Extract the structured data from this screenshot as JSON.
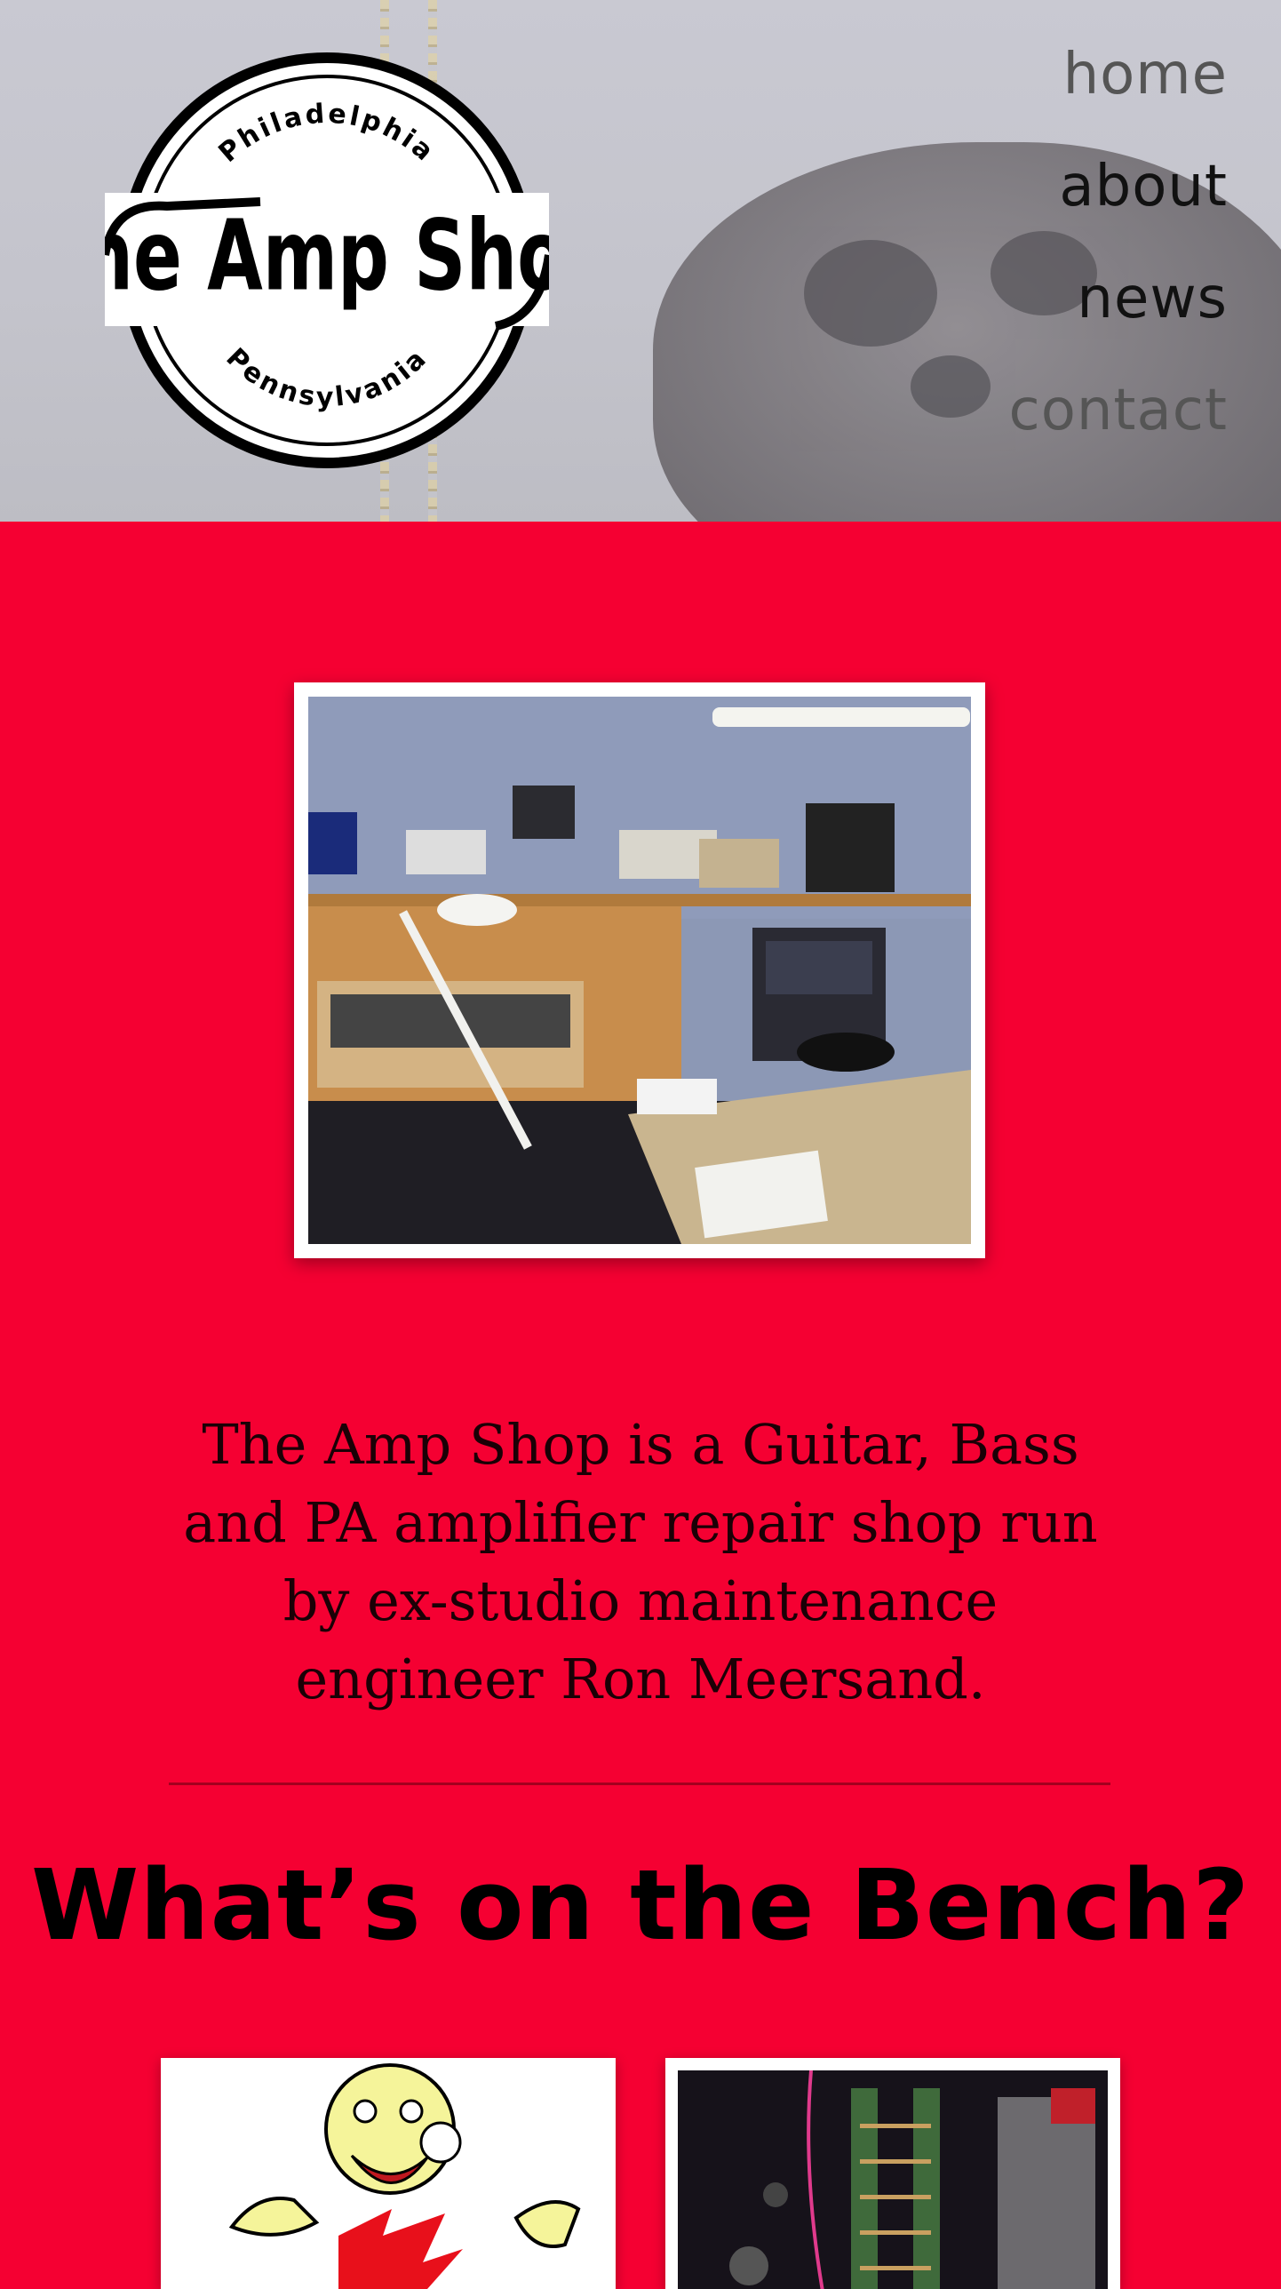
{
  "site": {
    "logo_text": "The Amp Shop",
    "logo_top": "Philadelphia",
    "logo_bottom": "Pennsylvania"
  },
  "nav": [
    {
      "label": "home"
    },
    {
      "label": "about"
    },
    {
      "label": "news"
    },
    {
      "label": "contact"
    }
  ],
  "main": {
    "intro": "The Amp Shop is a Guitar, Bass and PA amplifier repair shop run by ex-studio maintenance engineer Ron Meersand.",
    "bench_title": "What’s on the Bench?"
  },
  "colors": {
    "page_background": "#f50032",
    "header_background": "#c6c6ce"
  },
  "icons": [
    "logo-badge",
    "workshop-photo",
    "mascot-image",
    "amp-chassis-image"
  ]
}
